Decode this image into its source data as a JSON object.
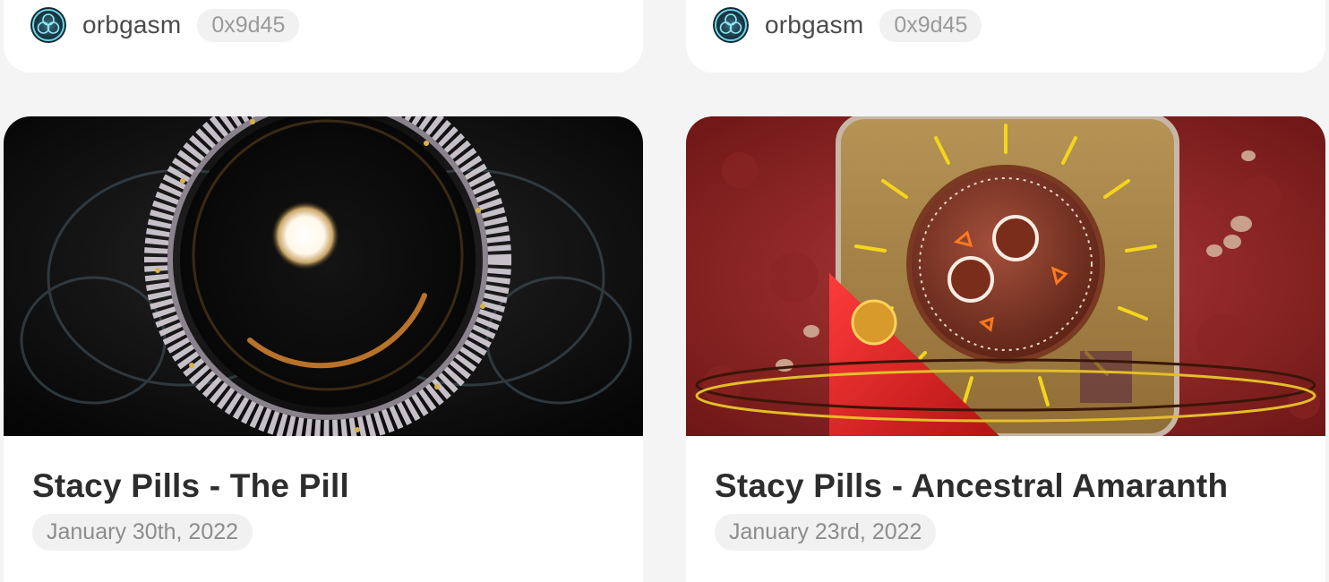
{
  "cards": [
    {
      "author": "orbgasm",
      "address": "0x9d45",
      "title": "Stacy Pills - The Pill",
      "date": "January 30th, 2022"
    },
    {
      "author": "orbgasm",
      "address": "0x9d45",
      "title": "Stacy Pills - Ancestral Amaranth",
      "date": "January 23rd, 2022"
    }
  ],
  "colors": {
    "background": "#f4f4f4",
    "card": "#ffffff",
    "badge": "#f1f1f1"
  }
}
